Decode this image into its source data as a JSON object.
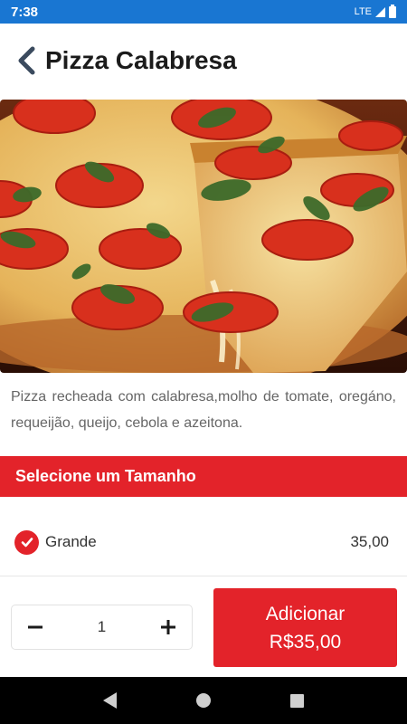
{
  "status_bar": {
    "time": "7:38",
    "network": "LTE"
  },
  "header": {
    "title": "Pizza Calabresa",
    "back_icon": "chevron-left-icon"
  },
  "product": {
    "description": "Pizza recheada com calabresa,molho de tomate, oregáno, requeijão, queijo, cebola e azeitona."
  },
  "size_section": {
    "title": "Selecione um Tamanho",
    "options": [
      {
        "label": "Grande",
        "price": "35,00",
        "selected": true,
        "icon": "check-circle-icon"
      }
    ]
  },
  "cart": {
    "quantity": "1",
    "minus_icon": "minus-icon",
    "plus_icon": "plus-icon",
    "add_label": "Adicionar",
    "add_price": "R$35,00"
  },
  "colors": {
    "accent": "#e3232a",
    "status_bar": "#1976d2"
  }
}
